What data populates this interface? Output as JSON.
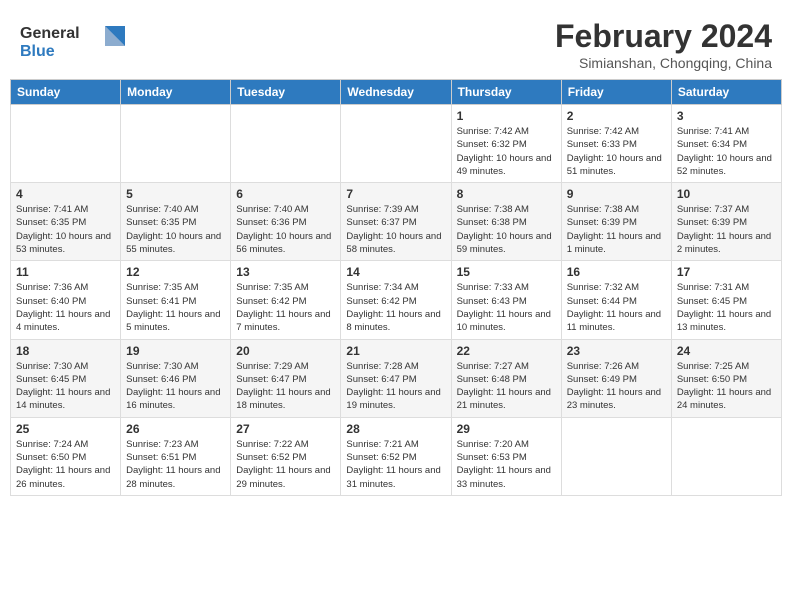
{
  "logo": {
    "general": "General",
    "blue": "Blue"
  },
  "title": "February 2024",
  "subtitle": "Simianshan, Chongqing, China",
  "days_header": [
    "Sunday",
    "Monday",
    "Tuesday",
    "Wednesday",
    "Thursday",
    "Friday",
    "Saturday"
  ],
  "weeks": [
    [
      {
        "day": "",
        "info": ""
      },
      {
        "day": "",
        "info": ""
      },
      {
        "day": "",
        "info": ""
      },
      {
        "day": "",
        "info": ""
      },
      {
        "day": "1",
        "info": "Sunrise: 7:42 AM\nSunset: 6:32 PM\nDaylight: 10 hours\nand 49 minutes."
      },
      {
        "day": "2",
        "info": "Sunrise: 7:42 AM\nSunset: 6:33 PM\nDaylight: 10 hours\nand 51 minutes."
      },
      {
        "day": "3",
        "info": "Sunrise: 7:41 AM\nSunset: 6:34 PM\nDaylight: 10 hours\nand 52 minutes."
      }
    ],
    [
      {
        "day": "4",
        "info": "Sunrise: 7:41 AM\nSunset: 6:35 PM\nDaylight: 10 hours\nand 53 minutes."
      },
      {
        "day": "5",
        "info": "Sunrise: 7:40 AM\nSunset: 6:35 PM\nDaylight: 10 hours\nand 55 minutes."
      },
      {
        "day": "6",
        "info": "Sunrise: 7:40 AM\nSunset: 6:36 PM\nDaylight: 10 hours\nand 56 minutes."
      },
      {
        "day": "7",
        "info": "Sunrise: 7:39 AM\nSunset: 6:37 PM\nDaylight: 10 hours\nand 58 minutes."
      },
      {
        "day": "8",
        "info": "Sunrise: 7:38 AM\nSunset: 6:38 PM\nDaylight: 10 hours\nand 59 minutes."
      },
      {
        "day": "9",
        "info": "Sunrise: 7:38 AM\nSunset: 6:39 PM\nDaylight: 11 hours\nand 1 minute."
      },
      {
        "day": "10",
        "info": "Sunrise: 7:37 AM\nSunset: 6:39 PM\nDaylight: 11 hours\nand 2 minutes."
      }
    ],
    [
      {
        "day": "11",
        "info": "Sunrise: 7:36 AM\nSunset: 6:40 PM\nDaylight: 11 hours\nand 4 minutes."
      },
      {
        "day": "12",
        "info": "Sunrise: 7:35 AM\nSunset: 6:41 PM\nDaylight: 11 hours\nand 5 minutes."
      },
      {
        "day": "13",
        "info": "Sunrise: 7:35 AM\nSunset: 6:42 PM\nDaylight: 11 hours\nand 7 minutes."
      },
      {
        "day": "14",
        "info": "Sunrise: 7:34 AM\nSunset: 6:42 PM\nDaylight: 11 hours\nand 8 minutes."
      },
      {
        "day": "15",
        "info": "Sunrise: 7:33 AM\nSunset: 6:43 PM\nDaylight: 11 hours\nand 10 minutes."
      },
      {
        "day": "16",
        "info": "Sunrise: 7:32 AM\nSunset: 6:44 PM\nDaylight: 11 hours\nand 11 minutes."
      },
      {
        "day": "17",
        "info": "Sunrise: 7:31 AM\nSunset: 6:45 PM\nDaylight: 11 hours\nand 13 minutes."
      }
    ],
    [
      {
        "day": "18",
        "info": "Sunrise: 7:30 AM\nSunset: 6:45 PM\nDaylight: 11 hours\nand 14 minutes."
      },
      {
        "day": "19",
        "info": "Sunrise: 7:30 AM\nSunset: 6:46 PM\nDaylight: 11 hours\nand 16 minutes."
      },
      {
        "day": "20",
        "info": "Sunrise: 7:29 AM\nSunset: 6:47 PM\nDaylight: 11 hours\nand 18 minutes."
      },
      {
        "day": "21",
        "info": "Sunrise: 7:28 AM\nSunset: 6:47 PM\nDaylight: 11 hours\nand 19 minutes."
      },
      {
        "day": "22",
        "info": "Sunrise: 7:27 AM\nSunset: 6:48 PM\nDaylight: 11 hours\nand 21 minutes."
      },
      {
        "day": "23",
        "info": "Sunrise: 7:26 AM\nSunset: 6:49 PM\nDaylight: 11 hours\nand 23 minutes."
      },
      {
        "day": "24",
        "info": "Sunrise: 7:25 AM\nSunset: 6:50 PM\nDaylight: 11 hours\nand 24 minutes."
      }
    ],
    [
      {
        "day": "25",
        "info": "Sunrise: 7:24 AM\nSunset: 6:50 PM\nDaylight: 11 hours\nand 26 minutes."
      },
      {
        "day": "26",
        "info": "Sunrise: 7:23 AM\nSunset: 6:51 PM\nDaylight: 11 hours\nand 28 minutes."
      },
      {
        "day": "27",
        "info": "Sunrise: 7:22 AM\nSunset: 6:52 PM\nDaylight: 11 hours\nand 29 minutes."
      },
      {
        "day": "28",
        "info": "Sunrise: 7:21 AM\nSunset: 6:52 PM\nDaylight: 11 hours\nand 31 minutes."
      },
      {
        "day": "29",
        "info": "Sunrise: 7:20 AM\nSunset: 6:53 PM\nDaylight: 11 hours\nand 33 minutes."
      },
      {
        "day": "",
        "info": ""
      },
      {
        "day": "",
        "info": ""
      }
    ]
  ]
}
